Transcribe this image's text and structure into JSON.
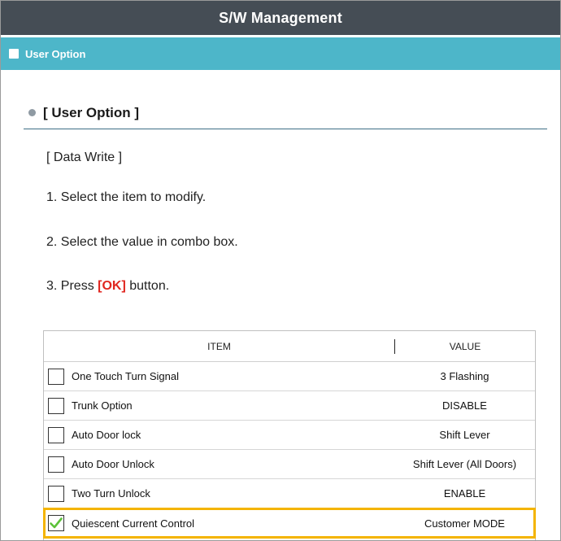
{
  "window": {
    "title": "S/W Management"
  },
  "section": {
    "label": "User Option"
  },
  "heading": {
    "text": "[ User Option ]"
  },
  "instructions": {
    "line0": "[ Data Write ]",
    "line1": "1. Select the item to modify.",
    "line2": "2. Select the value in combo box.",
    "line3_prefix": "3. Press ",
    "line3_ok": "[OK]",
    "line3_suffix": " button."
  },
  "table": {
    "headers": {
      "item": "ITEM",
      "value": "VALUE"
    },
    "rows": [
      {
        "item": "One Touch Turn Signal",
        "value": "3 Flashing",
        "checked": false
      },
      {
        "item": "Trunk Option",
        "value": "DISABLE",
        "checked": false
      },
      {
        "item": "Auto Door lock",
        "value": "Shift Lever",
        "checked": false
      },
      {
        "item": "Auto Door Unlock",
        "value": "Shift Lever (All Doors)",
        "checked": false
      },
      {
        "item": "Two Turn Unlock",
        "value": "ENABLE",
        "checked": false
      },
      {
        "item": "Quiescent Current Control",
        "value": "Customer MODE",
        "checked": true
      }
    ]
  },
  "colors": {
    "title_bar": "#454d55",
    "section_bar": "#4db6c9",
    "ok_text": "#e0261f",
    "selection_outline": "#f4b400",
    "check_mark": "#5cc23a"
  }
}
